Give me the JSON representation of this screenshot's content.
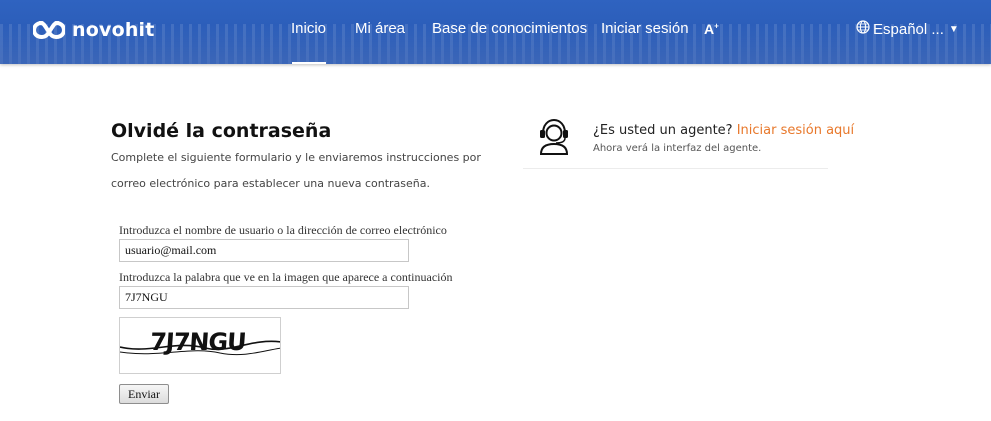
{
  "header": {
    "brand": "novohit",
    "nav": [
      "Inicio",
      "Mi área",
      "Base de conocimientos",
      "Iniciar sesión"
    ],
    "active_nav": "Inicio",
    "font_size_glyph": "A",
    "language": "Español ...",
    "icons": {
      "logo": "infinity-logo-icon",
      "font_size": "font-size-icon",
      "language": "globe-icon",
      "dropdown": "caret-down-icon"
    }
  },
  "form": {
    "title": "Olvidé la contraseña",
    "description": "Complete el siguiente formulario y le enviaremos instrucciones por correo electrónico para establecer una nueva contraseña.",
    "username_label": "Introduzca el nombre de usuario o la dirección de correo electrónico",
    "username_value": "usuario@mail.com",
    "captcha_label": "Introduzca la palabra que ve en la imagen que aparece a continuación",
    "captcha_value": "7J7NGU",
    "captcha_image_text": "7J7NGU",
    "submit_label": "Enviar"
  },
  "agent": {
    "question": "¿Es usted un agente?",
    "link": "Iniciar sesión aquí",
    "subtitle": "Ahora verá la interfaz del agente.",
    "icon": "headset-agent-icon",
    "link_color": "#e8782b"
  },
  "colors": {
    "header_bg": "#2d5fbd",
    "accent": "#e8782b"
  }
}
